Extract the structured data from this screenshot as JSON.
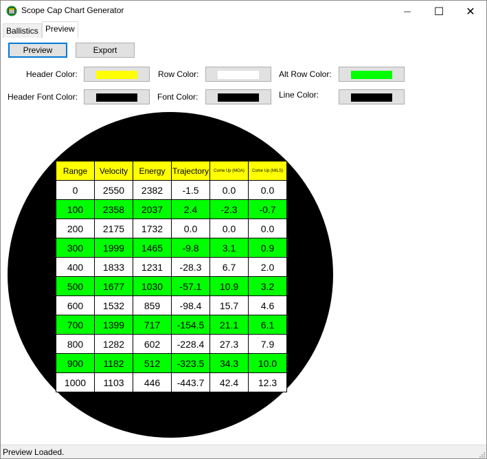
{
  "window": {
    "title": "Scope Cap Chart Generator",
    "minimize_glyph": "—",
    "maximize_glyph": "☐",
    "close_glyph": "✕"
  },
  "tabs": [
    {
      "label": "Ballistics",
      "active": false
    },
    {
      "label": "Preview",
      "active": true
    }
  ],
  "toolbar": {
    "preview_label": "Preview",
    "export_label": "Export"
  },
  "colors": {
    "header_color_label": "Header Color:",
    "header_color": "#ffff00",
    "row_color_label": "Row Color:",
    "row_color": "#ffffff",
    "alt_row_color_label": "Alt Row Color:",
    "alt_row_color": "#00ff00",
    "header_font_color_label": "Header Font Color:",
    "header_font_color": "#000000",
    "font_color_label": "Font Color:",
    "font_color": "#000000",
    "line_color_label": "Line Color:",
    "line_color": "#000000"
  },
  "chart": {
    "background": "#000000",
    "columns": [
      "Range",
      "Velocity",
      "Energy",
      "Trajectory",
      "Come Up (MOA)",
      "Come Up (MILS)"
    ],
    "rows": [
      [
        "0",
        "2550",
        "2382",
        "-1.5",
        "0.0",
        "0.0"
      ],
      [
        "100",
        "2358",
        "2037",
        "2.4",
        "-2.3",
        "-0.7"
      ],
      [
        "200",
        "2175",
        "1732",
        "0.0",
        "0.0",
        "0.0"
      ],
      [
        "300",
        "1999",
        "1465",
        "-9.8",
        "3.1",
        "0.9"
      ],
      [
        "400",
        "1833",
        "1231",
        "-28.3",
        "6.7",
        "2.0"
      ],
      [
        "500",
        "1677",
        "1030",
        "-57.1",
        "10.9",
        "3.2"
      ],
      [
        "600",
        "1532",
        "859",
        "-98.4",
        "15.7",
        "4.6"
      ],
      [
        "700",
        "1399",
        "717",
        "-154.5",
        "21.1",
        "6.1"
      ],
      [
        "800",
        "1282",
        "602",
        "-228.4",
        "27.3",
        "7.9"
      ],
      [
        "900",
        "1182",
        "512",
        "-323.5",
        "34.3",
        "10.0"
      ],
      [
        "1000",
        "1103",
        "446",
        "-443.7",
        "42.4",
        "12.3"
      ]
    ]
  },
  "status": {
    "text": "Preview Loaded."
  }
}
